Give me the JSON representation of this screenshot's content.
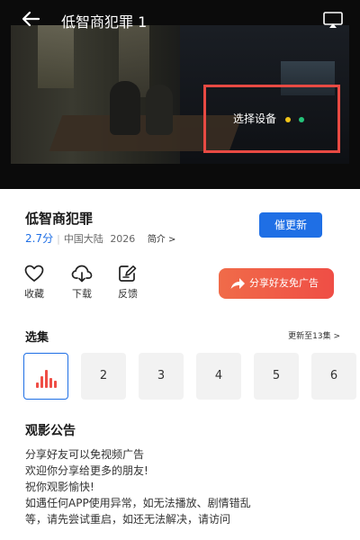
{
  "video": {
    "title": "低智商犯罪 1",
    "device_label": "选择设备"
  },
  "info": {
    "title": "低智商犯罪",
    "rating": "2.7分",
    "region": "中国大陆",
    "year": "2026",
    "intro_label": "简介 >",
    "update_button": "催更新"
  },
  "actions": {
    "favorite": "收藏",
    "download": "下载",
    "feedback": "反馈",
    "share": "分享好友免广告"
  },
  "episodes": {
    "section_title": "选集",
    "update_more": "更新至13集 >",
    "items": [
      "2",
      "3",
      "4",
      "5",
      "6"
    ]
  },
  "notice": {
    "title": "观影公告",
    "lines": [
      "分享好友可以免视频广告",
      "欢迎你分享给更多的朋友!",
      "祝你观影愉快!",
      "如遇任何APP使用异常，如无法播放、剧情错乱",
      "等，请先尝试重启，如还无法解决，请访问"
    ]
  },
  "colors": {
    "accent": "#1f6fe5",
    "share": "#ef4e46",
    "highlight_border": "#e84a43"
  },
  "icons": {
    "back": "back-arrow-icon",
    "cast": "cast-icon",
    "favorite": "heart-icon",
    "download": "cloud-download-icon",
    "feedback": "edit-icon",
    "share": "share-arrow-icon",
    "playing": "playing-bars-icon"
  }
}
